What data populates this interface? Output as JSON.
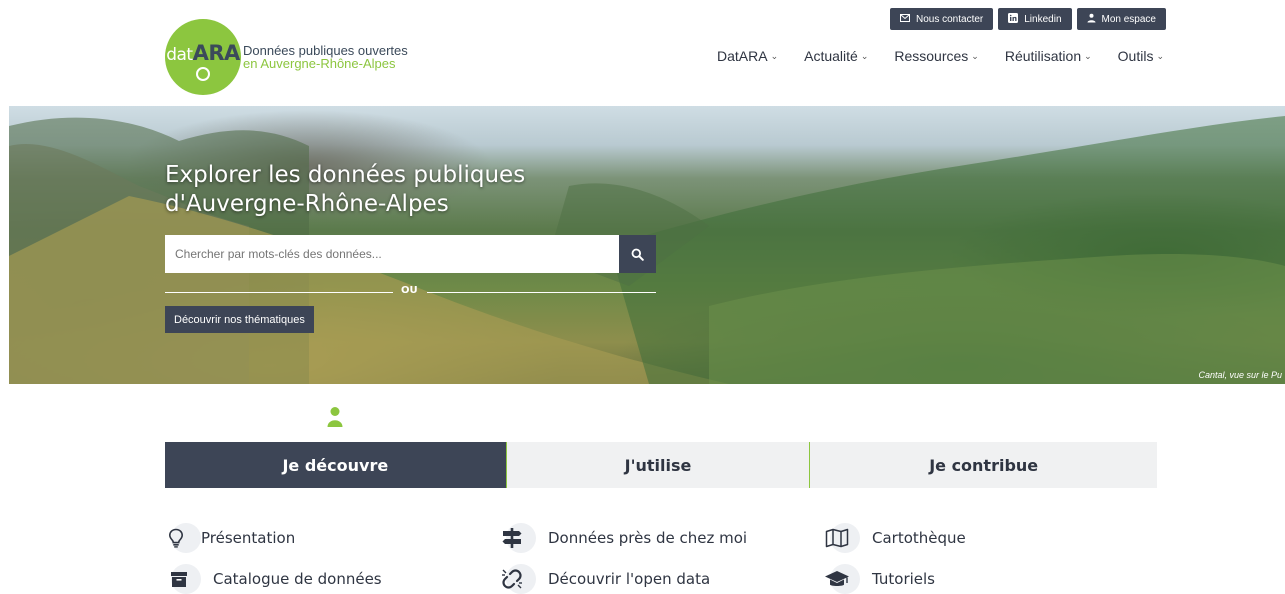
{
  "header": {
    "logo_part1": "dat",
    "logo_part2": "ARA",
    "brand_line1": "Données publiques ouvertes",
    "brand_line2": "en Auvergne-Rhône-Alpes",
    "top_buttons": [
      {
        "label": "Nous contacter",
        "icon": "mail-icon"
      },
      {
        "label": "Linkedin",
        "icon": "linkedin-icon"
      },
      {
        "label": "Mon espace",
        "icon": "user-icon"
      }
    ],
    "nav": [
      {
        "label": "DatARA"
      },
      {
        "label": "Actualité"
      },
      {
        "label": "Ressources"
      },
      {
        "label": "Réutilisation"
      },
      {
        "label": "Outils"
      }
    ]
  },
  "hero": {
    "title_line1": "Explorer les données publiques",
    "title_line2": "d'Auvergne-Rhône-Alpes",
    "search_placeholder": "Chercher par mots-clés des données...",
    "or_label": "OU",
    "themes_button": "Découvrir nos thématiques",
    "caption": "Cantal, vue sur le Pu"
  },
  "tabs": [
    {
      "label": "Je découvre",
      "active": true
    },
    {
      "label": "J'utilise",
      "active": false
    },
    {
      "label": "Je contribue",
      "active": false
    }
  ],
  "links": [
    {
      "label": "Présentation",
      "icon": "lightbulb-icon"
    },
    {
      "label": "Données près de chez moi",
      "icon": "signpost-icon"
    },
    {
      "label": "Cartothèque",
      "icon": "map-icon"
    },
    {
      "label": "Catalogue de données",
      "icon": "archive-box-icon"
    },
    {
      "label": "Découvrir l'open data",
      "icon": "broken-link-icon"
    },
    {
      "label": "Tutoriels",
      "icon": "graduation-cap-icon"
    }
  ],
  "colors": {
    "brand_green": "#8cc63f",
    "dark_slate": "#3d4556",
    "tab_bg": "#f0f1f2"
  }
}
